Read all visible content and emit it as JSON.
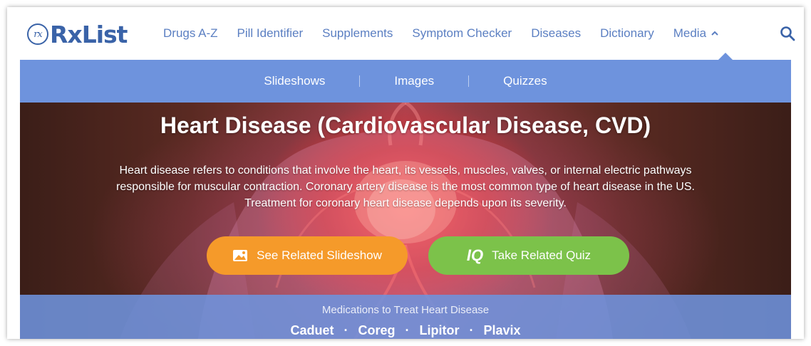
{
  "logo": {
    "mark": "rx",
    "text": "RxList"
  },
  "nav": {
    "items": [
      {
        "label": "Drugs A-Z"
      },
      {
        "label": "Pill Identifier"
      },
      {
        "label": "Supplements"
      },
      {
        "label": "Symptom Checker"
      },
      {
        "label": "Diseases"
      },
      {
        "label": "Dictionary"
      },
      {
        "label": "Media"
      }
    ],
    "search_icon": "search-icon",
    "media_icon": "chevron-up-icon"
  },
  "subnav": {
    "items": [
      {
        "label": "Slideshows"
      },
      {
        "label": "Images"
      },
      {
        "label": "Quizzes"
      }
    ]
  },
  "hero": {
    "title": "Heart Disease (Cardiovascular Disease, CVD)",
    "description": "Heart disease refers to conditions that involve the heart, its vessels, muscles, valves, or internal electric pathways responsible for muscular contraction. Coronary artery disease is the most common type of heart disease in the US. Treatment for coronary heart disease depends upon its severity.",
    "buttons": {
      "slideshow_label": "See Related Slideshow",
      "slideshow_icon": "image-icon",
      "quiz_badge": "IQ",
      "quiz_label": "Take Related Quiz"
    }
  },
  "medications": {
    "title": "Medications to Treat Heart Disease",
    "items": [
      "Caduet",
      "Coreg",
      "Lipitor",
      "Plavix"
    ],
    "separator": "·"
  },
  "colors": {
    "brand_blue": "#3a63a8",
    "nav_link": "#5b7fc2",
    "subnav_bg": "#6e93dd",
    "slideshow_button": "#f59a2a",
    "quiz_button": "#7cc24a"
  }
}
